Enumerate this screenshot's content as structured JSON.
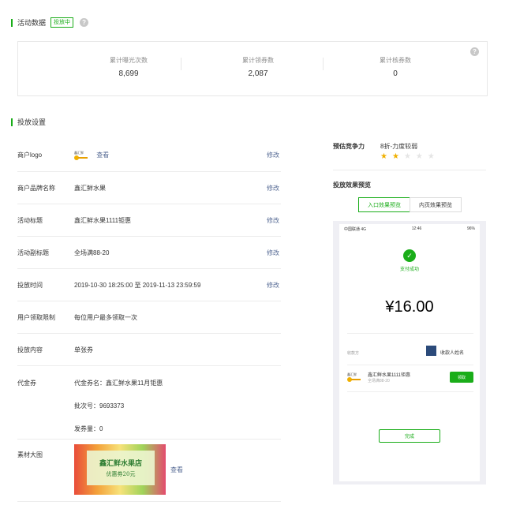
{
  "activity": {
    "title": "活动数据",
    "status": "投放中",
    "help": "?"
  },
  "stats": [
    {
      "label": "累计曝光次数",
      "value": "8,699"
    },
    {
      "label": "累计领券数",
      "value": "2,087"
    },
    {
      "label": "累计核券数",
      "value": "0"
    }
  ],
  "settings": {
    "title": "投放设置",
    "edit_label": "修改",
    "logo_row": {
      "label": "商户logo",
      "view": "查看",
      "logo_text": "鑫汇鲜"
    },
    "brand_row": {
      "label": "商户品牌名称",
      "value": "鑫汇鲜水果"
    },
    "title_row": {
      "label": "活动标题",
      "value": "鑫汇鲜水果1111钜惠"
    },
    "subtitle_row": {
      "label": "活动副标题",
      "value": "全场满88-20"
    },
    "time_row": {
      "label": "投放时间",
      "value": "2019-10-30 18:25:00 至 2019-11-13 23:59:59"
    },
    "limit_row": {
      "label": "用户领取限制",
      "value": "每位用户最多领取一次"
    },
    "content_row": {
      "label": "投放内容",
      "value": "单张券"
    },
    "voucher_row": {
      "label": "代金券",
      "name": "代金券名：鑫汇鲜水果11月钜惠",
      "batch": "批次号：9693373",
      "issued": "发券量：0"
    },
    "material_row": {
      "label": "素材大图",
      "view": "查看",
      "banner_title": "鑫汇鲜水果店",
      "banner_sub": "优惠券20元"
    }
  },
  "competitiveness": {
    "label": "预估竞争力",
    "value": "8折-力度较弱",
    "stars_filled": 2,
    "stars_total": 5
  },
  "preview": {
    "title": "投放效果预览",
    "tabs": [
      "入口效果预览",
      "内页效果预览"
    ],
    "statusbar": {
      "carrier": "中国联通 4G",
      "time": "12:46",
      "battery": "96%"
    },
    "pay_success": "支付成功",
    "amount": "¥16.00",
    "payee_label": "收款方",
    "payee_name": "收款人姓名",
    "coupon_logo": "鑫汇鲜",
    "coupon_title": "鑫汇鲜水果1111钜惠",
    "coupon_sub": "全场满88-20",
    "coupon_btn": "领取",
    "done_btn": "完成"
  },
  "colors": {
    "brand_green": "#1aad19",
    "link": "#576b95",
    "star": "#f0b000"
  }
}
